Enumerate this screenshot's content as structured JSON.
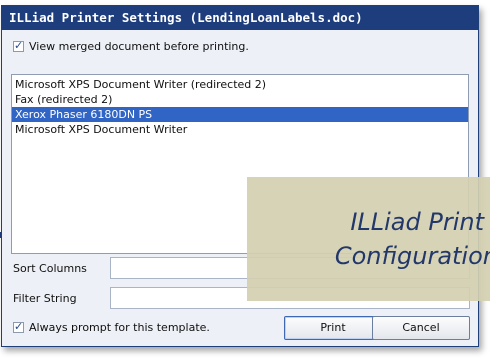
{
  "window": {
    "title": "ILLiad Printer Settings (LendingLoanLabels.doc)"
  },
  "options": {
    "view_merged_label": "View merged document before printing.",
    "view_merged_checked": true,
    "always_prompt_label": "Always prompt for this template.",
    "always_prompt_checked": true
  },
  "printers": {
    "items": [
      {
        "label": "Microsoft XPS Document Writer (redirected 2)",
        "selected": false
      },
      {
        "label": "Fax (redirected 2)",
        "selected": false
      },
      {
        "label": "Xerox Phaser 6180DN PS",
        "selected": true
      },
      {
        "label": "Microsoft XPS Document Writer",
        "selected": false
      }
    ]
  },
  "fields": {
    "sort_columns_label": "Sort Columns",
    "sort_columns_value": "",
    "filter_string_label": "Filter String",
    "filter_string_value": ""
  },
  "buttons": {
    "print_label": "Print",
    "cancel_label": "Cancel"
  },
  "overlay": {
    "line1": "ILLiad Print",
    "line2": "Configuration"
  },
  "colors": {
    "titlebar": "#1e3d7d",
    "selection": "#3064c5",
    "overlay": "#d4cfb0",
    "overlay_text": "#23386a"
  }
}
